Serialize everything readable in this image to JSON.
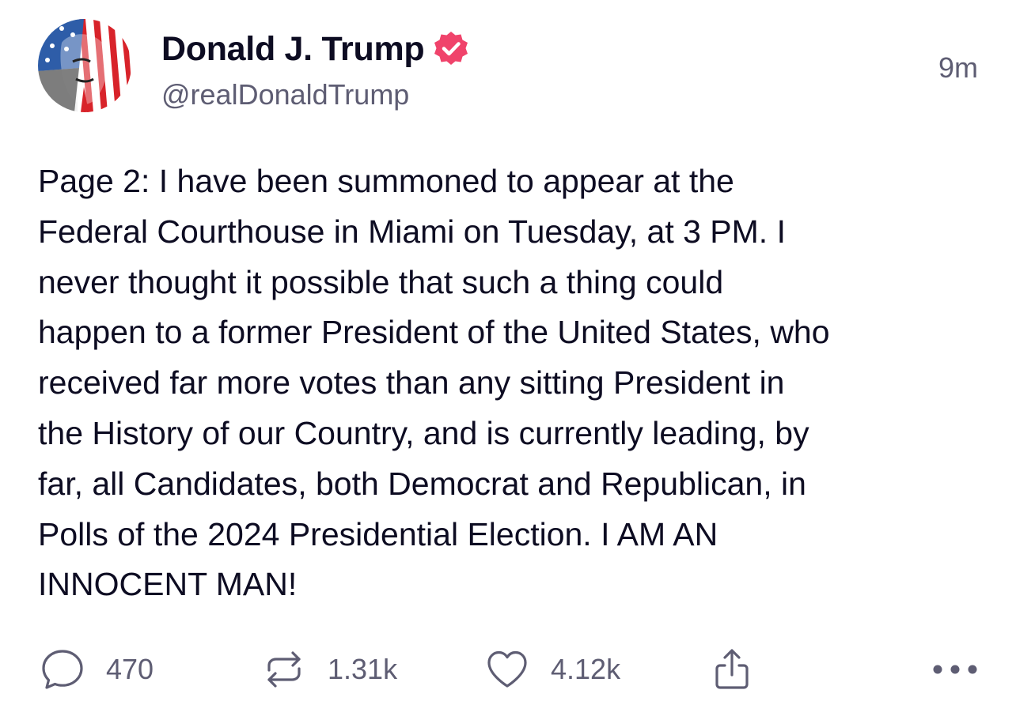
{
  "post": {
    "author": {
      "display_name": "Donald J. Trump",
      "handle": "@realDonaldTrump",
      "verified": true,
      "avatar_icon": "avatar-flag-portrait"
    },
    "timestamp": "9m",
    "body": "Page 2: I have been summoned to appear at the\nFederal Courthouse in Miami on Tuesday, at 3 PM. I\nnever thought it possible that such a thing could\nhappen to a former President of the United States, who\nreceived far more votes than any sitting President in\nthe History of our Country, and is currently leading, by\nfar, all Candidates, both Democrat and Republican, in\nPolls of the 2024 Presidential Election. I AM AN\nINNOCENT MAN!",
    "actions": {
      "reply": {
        "icon": "reply-icon",
        "count": "470"
      },
      "retruth": {
        "icon": "retruth-icon",
        "count": "1.31k"
      },
      "like": {
        "icon": "heart-icon",
        "count": "4.12k"
      },
      "share": {
        "icon": "share-icon"
      },
      "more": {
        "icon": "more-icon"
      }
    }
  },
  "colors": {
    "text_primary": "#0d0c22",
    "text_secondary": "#5e5d73",
    "verified_badge": "#f0436b",
    "icon_gray": "#5e5d73"
  }
}
